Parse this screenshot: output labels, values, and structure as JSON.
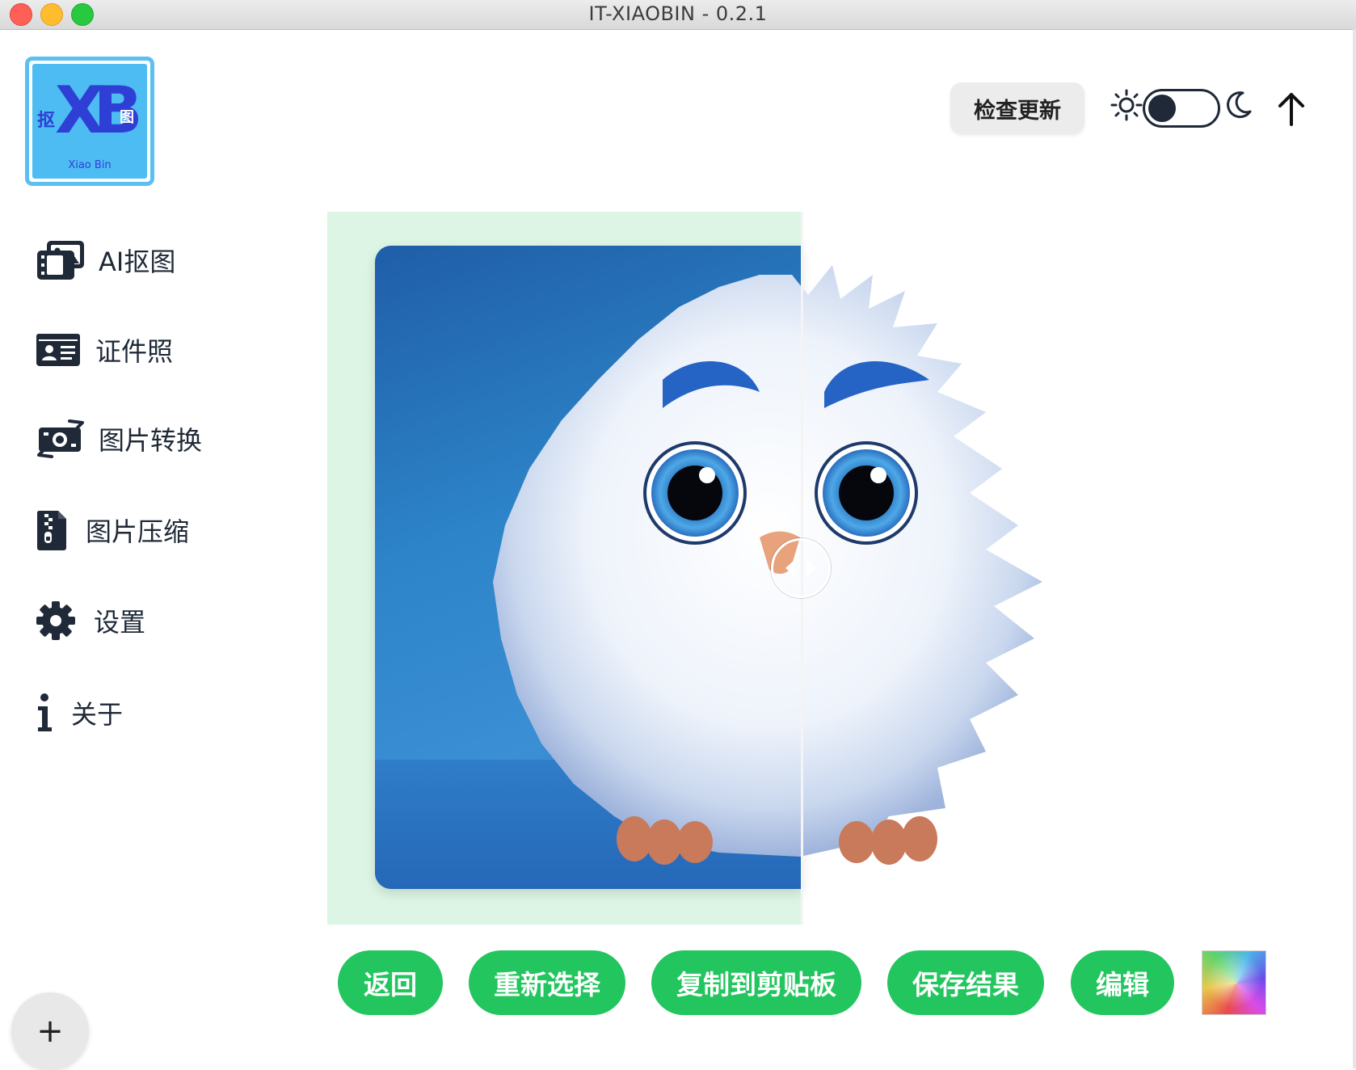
{
  "window": {
    "title": "IT-XIAOBIN - 0.2.1"
  },
  "logo": {
    "mark": "XB",
    "left_char": "抠",
    "right_char": "图",
    "subtitle": "Xiao Bin"
  },
  "header": {
    "check_update_label": "检查更新",
    "theme_mode": "light",
    "icons": [
      "sun-icon",
      "moon-icon",
      "upload-arrow-icon"
    ]
  },
  "sidebar": {
    "items": [
      {
        "label": "AI抠图",
        "icon": "images-icon"
      },
      {
        "label": "证件照",
        "icon": "id-card-icon"
      },
      {
        "label": "图片转换",
        "icon": "convert-icon"
      },
      {
        "label": "图片压缩",
        "icon": "file-zip-icon"
      },
      {
        "label": "设置",
        "icon": "gear-icon"
      },
      {
        "label": "关于",
        "icon": "info-icon"
      }
    ],
    "add_label": "+"
  },
  "compare": {
    "original_bg": "#2d84c8",
    "result_bg": "transparent",
    "slider_position_percent": 50
  },
  "actions": {
    "back": "返回",
    "reselect": "重新选择",
    "copy": "复制到剪贴板",
    "save": "保存结果",
    "edit": "编辑"
  },
  "colors": {
    "accent_green": "#22c55e",
    "text_dark": "#1f2937",
    "compare_bg": "#ddf5e4"
  }
}
